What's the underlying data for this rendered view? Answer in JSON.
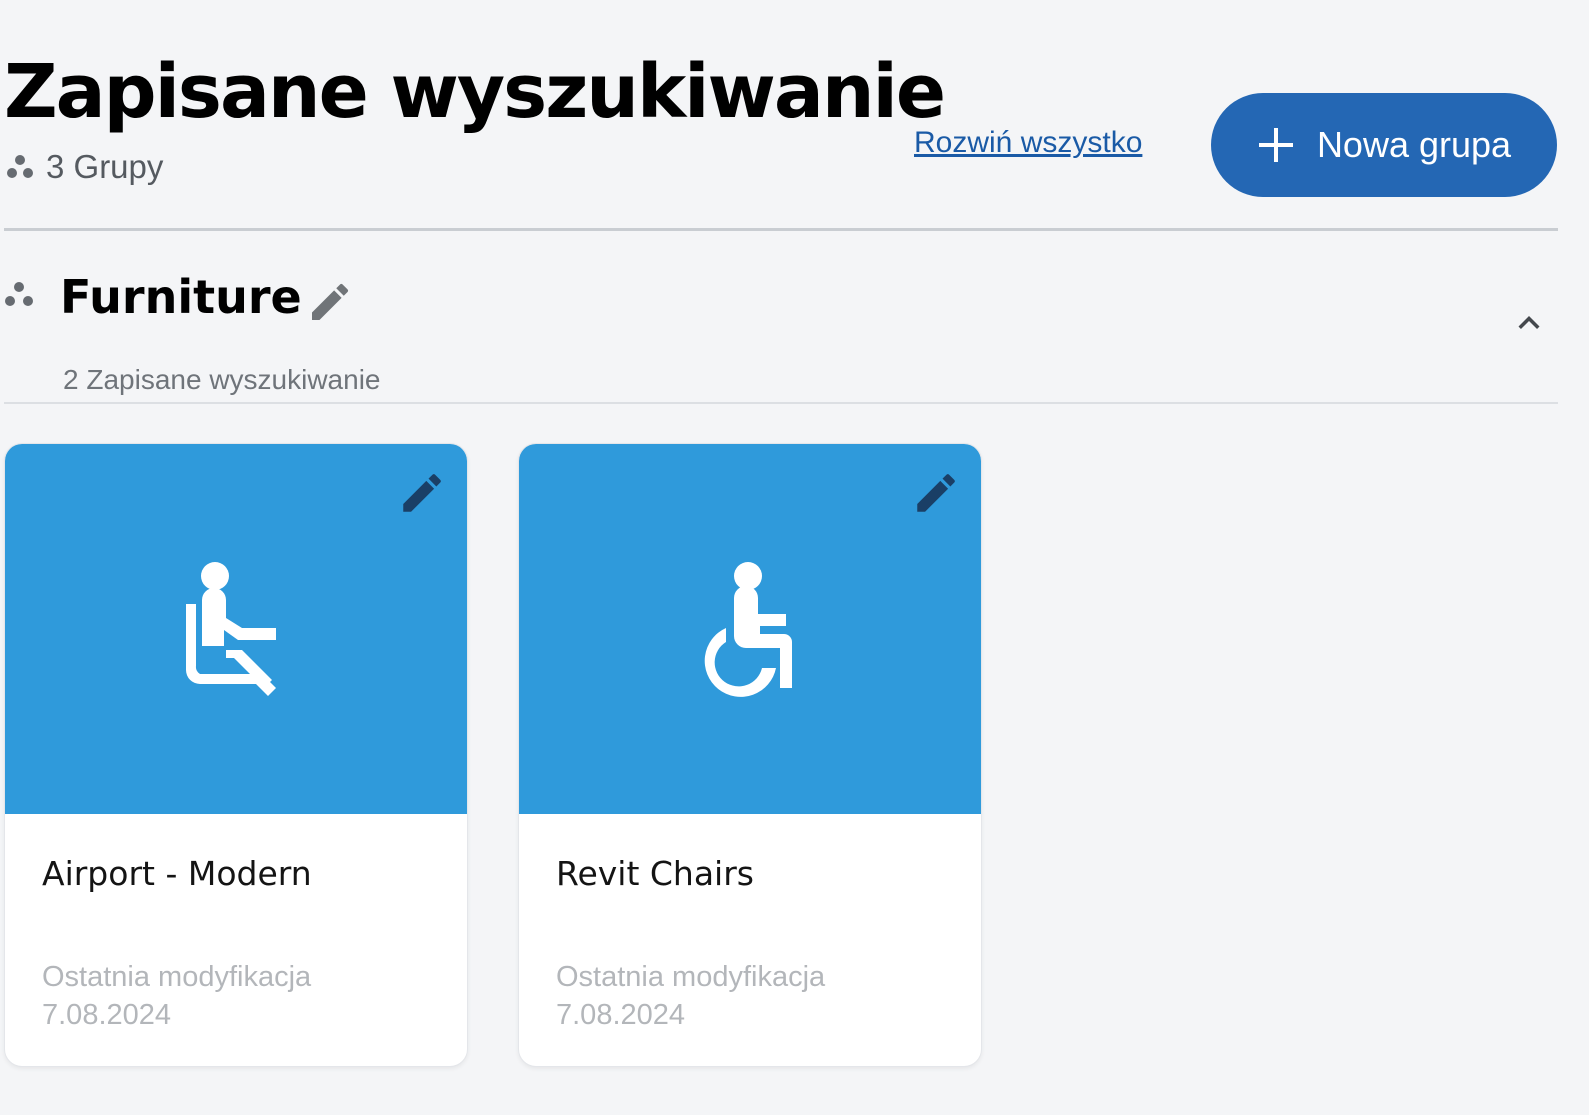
{
  "header": {
    "title": "Zapisane wyszukiwanie",
    "group_count": "3 Grupy",
    "expand_all": "Rozwiń wszystko",
    "new_group": "Nowa grupa"
  },
  "colors": {
    "primary_button": "#2467b4",
    "card_banner": "#2f9adb",
    "link": "#1a5aa6"
  },
  "group": {
    "name": "Furniture",
    "subtitle": "2 Zapisane wyszukiwanie",
    "expanded": true,
    "cards": [
      {
        "title": "Airport - Modern",
        "meta_label": "Ostatnia modyfikacja",
        "meta_date": "7.08.2024",
        "icon": "airline-seat-icon"
      },
      {
        "title": "Revit Chairs",
        "meta_label": "Ostatnia modyfikacja",
        "meta_date": "7.08.2024",
        "icon": "accessible-icon"
      }
    ]
  }
}
